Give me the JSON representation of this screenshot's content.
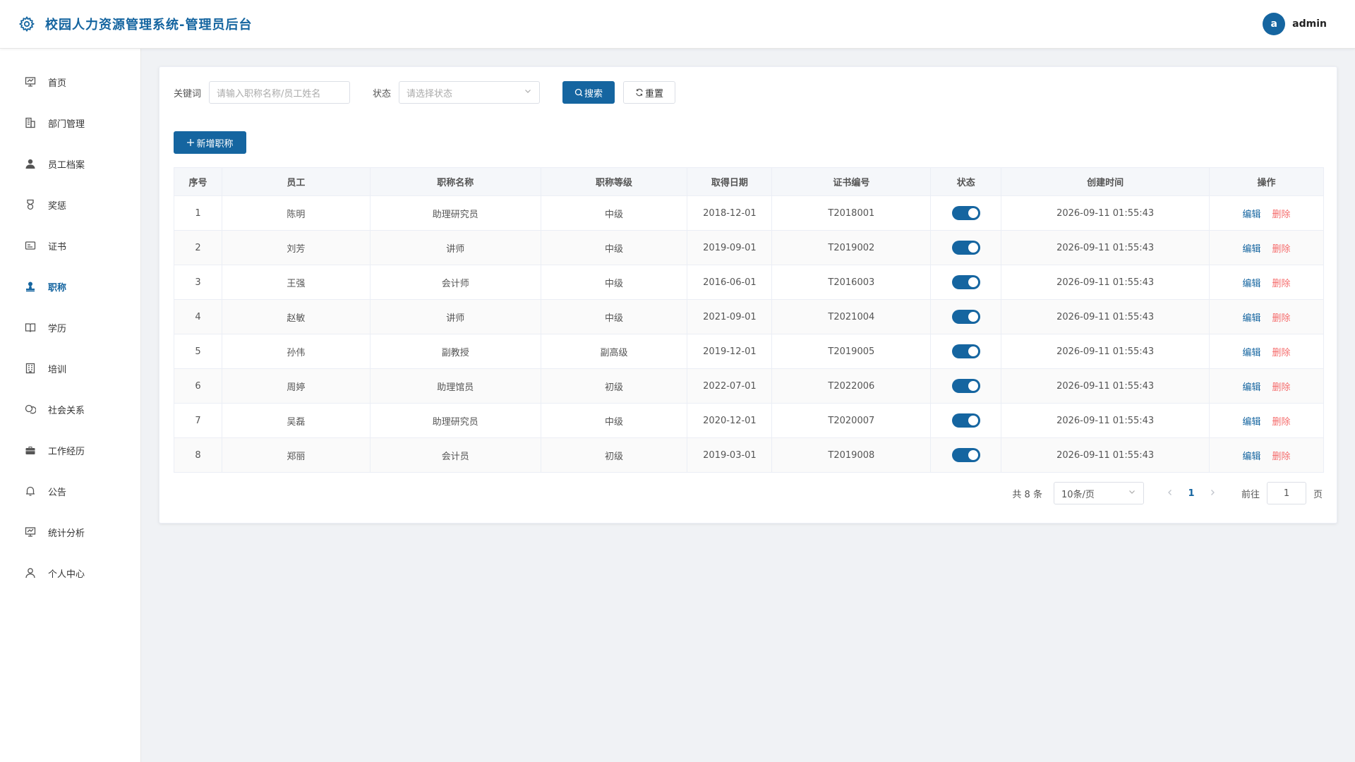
{
  "header": {
    "title": "校园人力资源管理系统-管理员后台",
    "logo_icon": "gear-icon",
    "user": {
      "avatar_letter": "a",
      "name": "admin"
    }
  },
  "sidebar": {
    "items": [
      {
        "label": "首页",
        "icon": "dashboard-icon"
      },
      {
        "label": "部门管理",
        "icon": "building-icon"
      },
      {
        "label": "员工档案",
        "icon": "user-icon"
      },
      {
        "label": "奖惩",
        "icon": "medal-icon"
      },
      {
        "label": "证书",
        "icon": "id-card-icon"
      },
      {
        "label": "职称",
        "icon": "stamp-icon"
      },
      {
        "label": "学历",
        "icon": "book-icon"
      },
      {
        "label": "培训",
        "icon": "office-icon"
      },
      {
        "label": "社会关系",
        "icon": "chat-icon"
      },
      {
        "label": "工作经历",
        "icon": "briefcase-icon"
      },
      {
        "label": "公告",
        "icon": "bell-icon"
      },
      {
        "label": "统计分析",
        "icon": "chart-icon"
      },
      {
        "label": "个人中心",
        "icon": "person-icon"
      }
    ],
    "active_index": 5
  },
  "search": {
    "keyword_label": "关键词",
    "keyword_placeholder": "请输入职称名称/员工姓名",
    "status_label": "状态",
    "status_placeholder": "请选择状态",
    "search_button": "搜索",
    "reset_button": "重置"
  },
  "add_button": "新增职称",
  "table": {
    "headers": [
      "序号",
      "员工",
      "职称名称",
      "职称等级",
      "取得日期",
      "证书编号",
      "状态",
      "创建时间",
      "操作"
    ],
    "rows": [
      {
        "no": "1",
        "employee": "陈明",
        "title": "助理研究员",
        "level": "中级",
        "date": "2018-12-01",
        "cert": "T2018001",
        "enabled": true,
        "created": "2026-09-11 01:55:43"
      },
      {
        "no": "2",
        "employee": "刘芳",
        "title": "讲师",
        "level": "中级",
        "date": "2019-09-01",
        "cert": "T2019002",
        "enabled": true,
        "created": "2026-09-11 01:55:43"
      },
      {
        "no": "3",
        "employee": "王强",
        "title": "会计师",
        "level": "中级",
        "date": "2016-06-01",
        "cert": "T2016003",
        "enabled": true,
        "created": "2026-09-11 01:55:43"
      },
      {
        "no": "4",
        "employee": "赵敏",
        "title": "讲师",
        "level": "中级",
        "date": "2021-09-01",
        "cert": "T2021004",
        "enabled": true,
        "created": "2026-09-11 01:55:43"
      },
      {
        "no": "5",
        "employee": "孙伟",
        "title": "副教授",
        "level": "副高级",
        "date": "2019-12-01",
        "cert": "T2019005",
        "enabled": true,
        "created": "2026-09-11 01:55:43"
      },
      {
        "no": "6",
        "employee": "周婷",
        "title": "助理馆员",
        "level": "初级",
        "date": "2022-07-01",
        "cert": "T2022006",
        "enabled": true,
        "created": "2026-09-11 01:55:43"
      },
      {
        "no": "7",
        "employee": "吴磊",
        "title": "助理研究员",
        "level": "中级",
        "date": "2020-12-01",
        "cert": "T2020007",
        "enabled": true,
        "created": "2026-09-11 01:55:43"
      },
      {
        "no": "8",
        "employee": "郑丽",
        "title": "会计员",
        "level": "初级",
        "date": "2019-03-01",
        "cert": "T2019008",
        "enabled": true,
        "created": "2026-09-11 01:55:43"
      }
    ],
    "edit_label": "编辑",
    "delete_label": "删除"
  },
  "pagination": {
    "total_text": "共 8 条",
    "page_size": "10条/页",
    "current_page": "1",
    "goto_label": "前往",
    "goto_value": "1",
    "page_suffix": "页"
  },
  "colors": {
    "primary": "#1565a0",
    "danger": "#f56c6c"
  }
}
